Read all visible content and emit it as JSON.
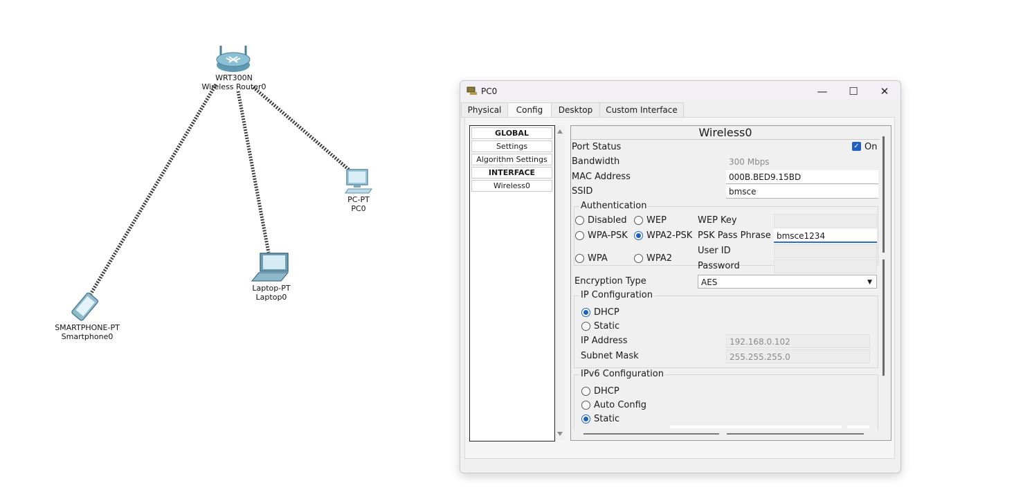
{
  "topology": {
    "router": {
      "model": "WRT300N",
      "name": "Wireless Router0"
    },
    "pc": {
      "model": "PC-PT",
      "name": "PC0"
    },
    "laptop": {
      "model": "Laptop-PT",
      "name": "Laptop0"
    },
    "phone": {
      "model": "SMARTPHONE-PT",
      "name": "Smartphone0"
    }
  },
  "window": {
    "title": "PC0",
    "minimize": "—",
    "maximize": "☐",
    "close": "✕",
    "tabs": [
      "Physical",
      "Config",
      "Desktop",
      "Custom Interface"
    ],
    "active_tab": "Config"
  },
  "sidebar": {
    "items": [
      "GLOBAL",
      "Settings",
      "Algorithm Settings",
      "INTERFACE",
      "Wireless0"
    ]
  },
  "wireless": {
    "title": "Wireless0",
    "port_status_label": "Port Status",
    "port_status_value": "On",
    "bandwidth_label": "Bandwidth",
    "bandwidth_value": "300 Mbps",
    "mac_label": "MAC Address",
    "mac_value": "000B.BED9.15BD",
    "ssid_label": "SSID",
    "ssid_value": "bmsce",
    "auth": {
      "title": "Authentication",
      "disabled": "Disabled",
      "wep": "WEP",
      "wep_key": "WEP Key",
      "wpa_psk": "WPA-PSK",
      "wpa2_psk": "WPA2-PSK",
      "psk_phrase_label": "PSK Pass Phrase",
      "psk_phrase_value": "bmsce1234",
      "wpa": "WPA",
      "wpa2": "WPA2",
      "user_id": "User ID",
      "password": "Password",
      "selected": "WPA2-PSK"
    },
    "encryption_label": "Encryption Type",
    "encryption_value": "AES",
    "ip": {
      "title": "IP Configuration",
      "dhcp": "DHCP",
      "static": "Static",
      "selected": "DHCP",
      "ip_label": "IP Address",
      "ip_value": "192.168.0.102",
      "mask_label": "Subnet Mask",
      "mask_value": "255.255.255.0"
    },
    "ipv6": {
      "title": "IPv6 Configuration",
      "dhcp": "DHCP",
      "auto": "Auto Config",
      "static": "Static",
      "selected": "Static"
    }
  },
  "colors": {
    "accent": "#1f5fbf",
    "cable": "#333333",
    "device": "#6ea7bd"
  }
}
